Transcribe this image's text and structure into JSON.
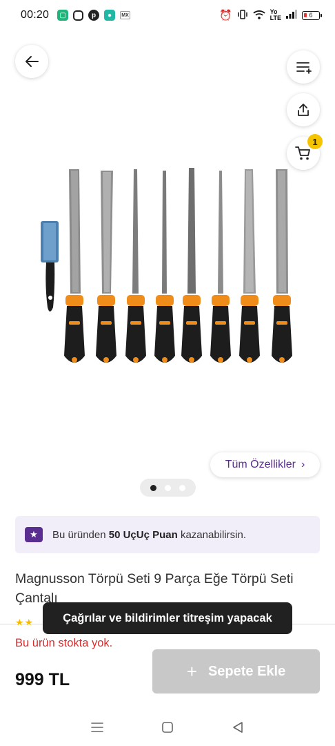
{
  "status_bar": {
    "time": "00:20",
    "battery": "6",
    "notification_icons": [
      "green-app-icon",
      "instagram-icon",
      "pinterest-icon",
      "teal-chat-icon",
      "mx-app-icon"
    ],
    "system_icons": [
      "alarm-icon",
      "vibrate-icon",
      "wifi-icon",
      "volte-icon",
      "signal-icon",
      "battery-icon"
    ]
  },
  "header": {
    "back_icon": "arrow-left-icon",
    "filter_icon": "list-plus-icon",
    "share_icon": "share-icon",
    "cart_icon": "cart-icon",
    "cart_count": "1"
  },
  "gallery": {
    "total_images": 3,
    "active_index": 0,
    "all_features_label": "Tüm Özellikler",
    "all_features_chevron": "›"
  },
  "points_banner": {
    "prefix": "Bu üründen",
    "points": "50 UçUç Puan",
    "suffix": "kazanabilirsin."
  },
  "product": {
    "title": "Magnusson Törpü Seti 9 Parça Eğe Törpü Seti Çantalı"
  },
  "toast": {
    "message": "Çağrılar ve bildirimler titreşim yapacak"
  },
  "purchase": {
    "stock_status": "Bu ürün stokta yok.",
    "price": "999 TL",
    "add_to_cart_label": "Sepete Ekle",
    "add_to_cart_disabled": true
  },
  "colors": {
    "brand_purple": "#5a2d91",
    "badge_yellow": "#f5c400",
    "out_of_stock_red": "#d32f2f",
    "disabled_button": "#c8c8c8"
  }
}
